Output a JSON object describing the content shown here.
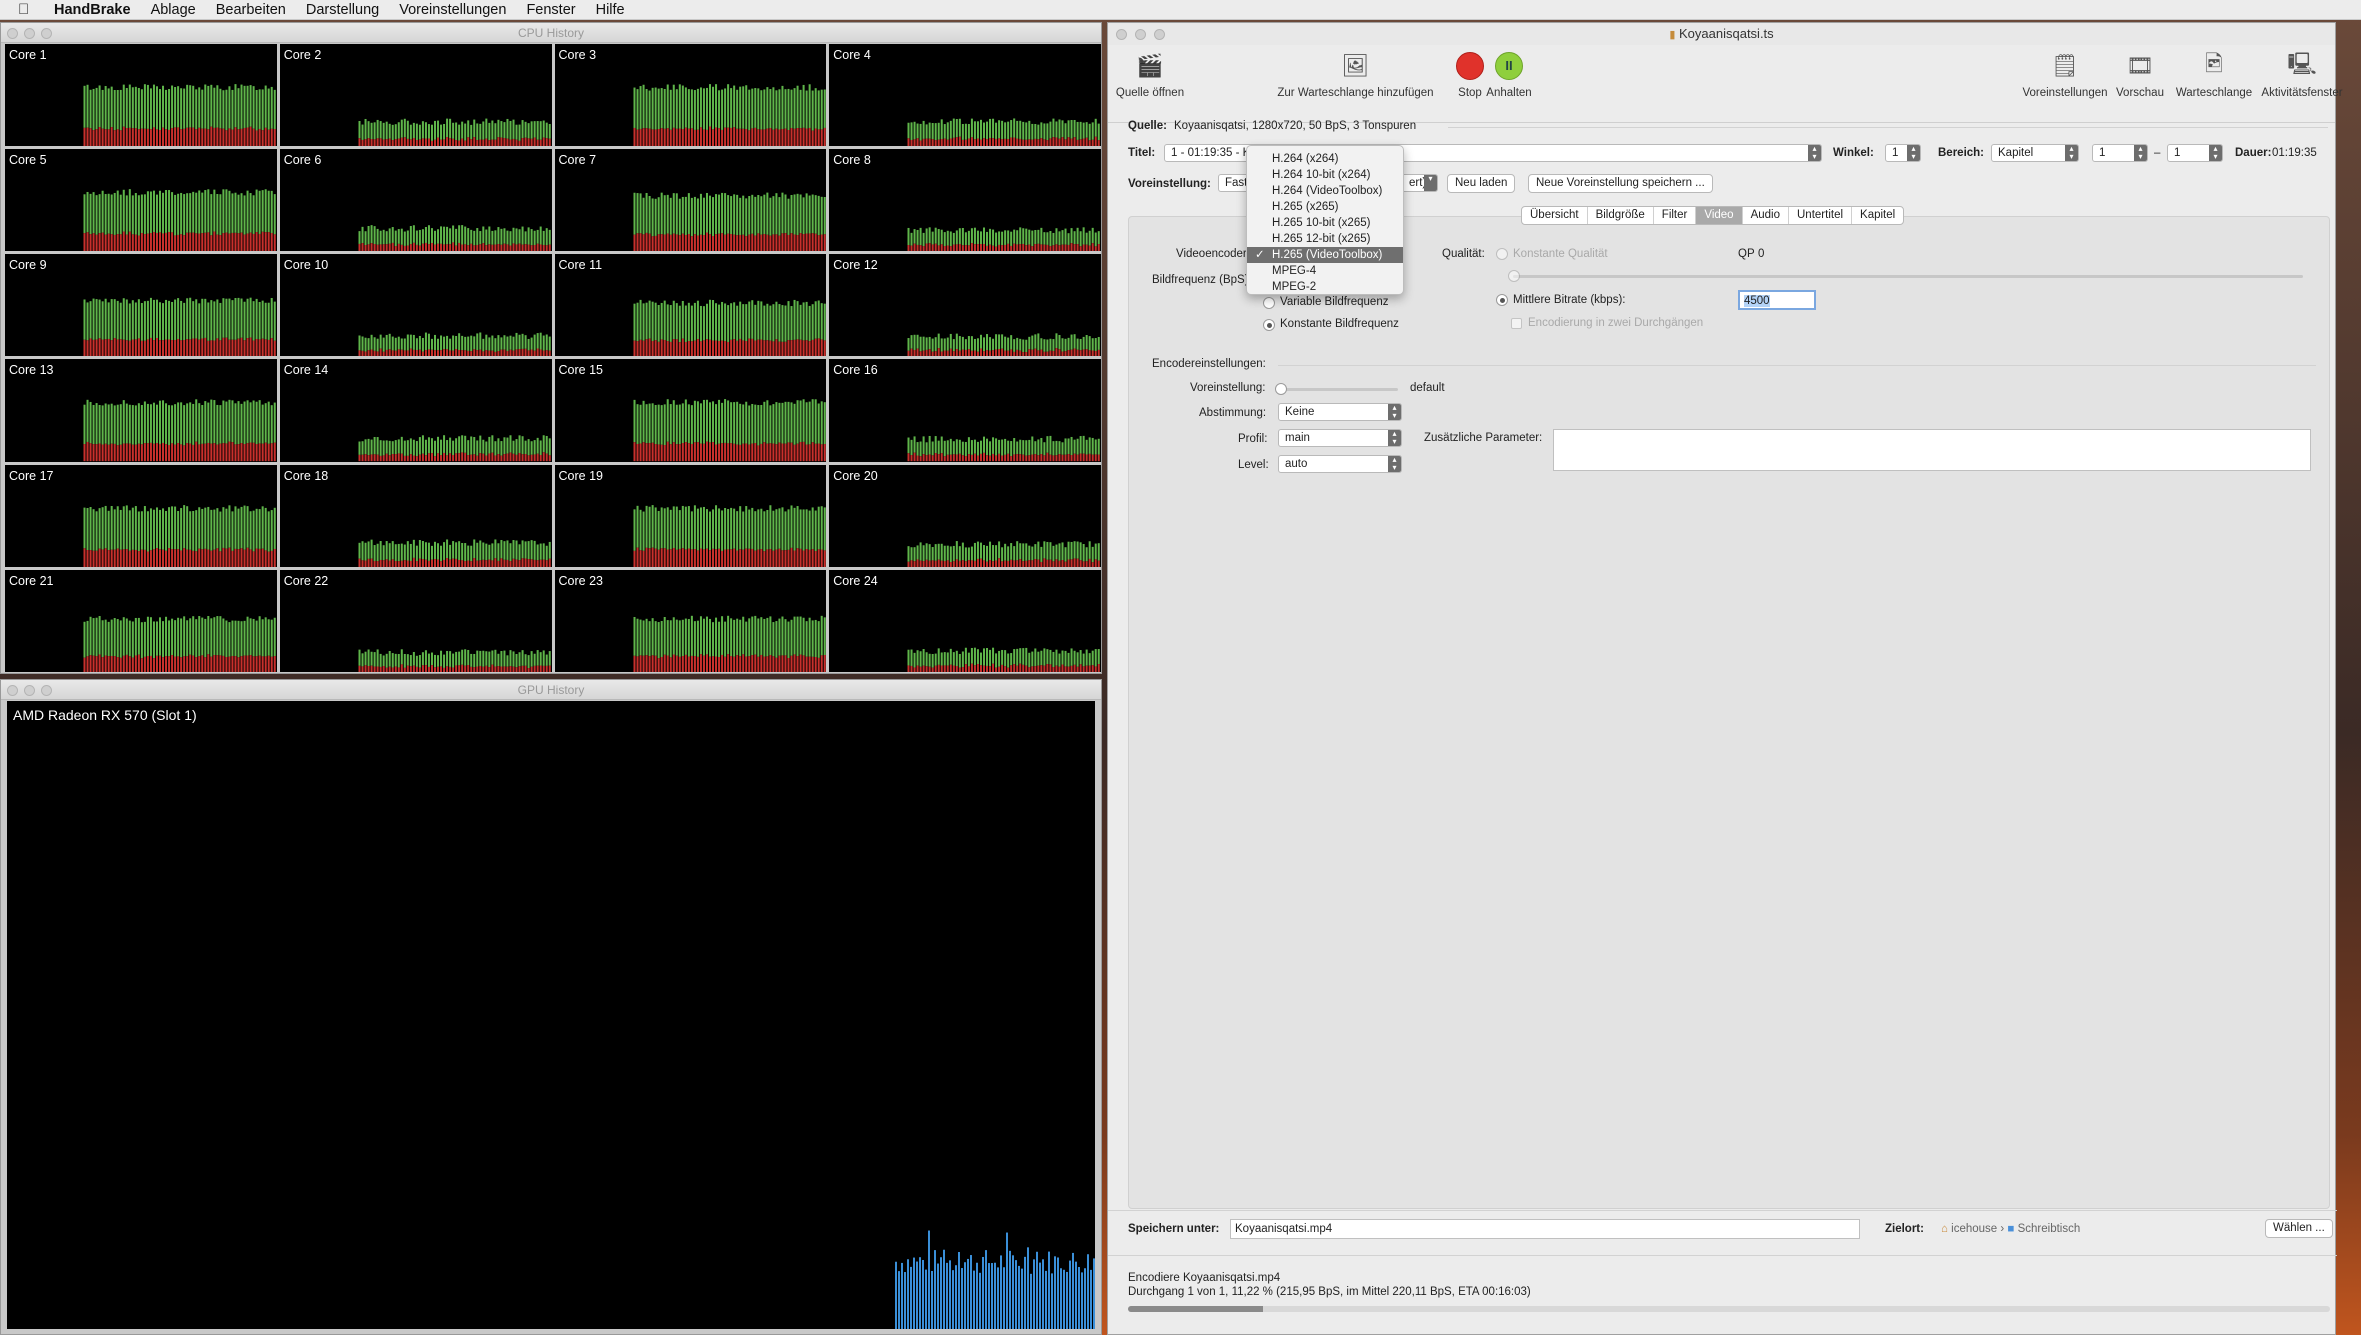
{
  "menubar": {
    "app": "HandBrake",
    "items": [
      "Ablage",
      "Bearbeiten",
      "Darstellung",
      "Voreinstellungen",
      "Fenster",
      "Hilfe"
    ]
  },
  "cpu_window": {
    "title": "CPU History",
    "cores": [
      {
        "label": "Core 1",
        "level": 0.72
      },
      {
        "label": "Core 2",
        "level": 0.3
      },
      {
        "label": "Core 3",
        "level": 0.72
      },
      {
        "label": "Core 4",
        "level": 0.3
      },
      {
        "label": "Core 5",
        "level": 0.72
      },
      {
        "label": "Core 6",
        "level": 0.28
      },
      {
        "label": "Core 7",
        "level": 0.68
      },
      {
        "label": "Core 8",
        "level": 0.26
      },
      {
        "label": "Core 9",
        "level": 0.68
      },
      {
        "label": "Core 10",
        "level": 0.25
      },
      {
        "label": "Core 11",
        "level": 0.65
      },
      {
        "label": "Core 12",
        "level": 0.24
      },
      {
        "label": "Core 13",
        "level": 0.72
      },
      {
        "label": "Core 14",
        "level": 0.28
      },
      {
        "label": "Core 15",
        "level": 0.72
      },
      {
        "label": "Core 16",
        "level": 0.27
      },
      {
        "label": "Core 17",
        "level": 0.72
      },
      {
        "label": "Core 18",
        "level": 0.3
      },
      {
        "label": "Core 19",
        "level": 0.72
      },
      {
        "label": "Core 20",
        "level": 0.28
      },
      {
        "label": "Core 21",
        "level": 0.65
      },
      {
        "label": "Core 22",
        "level": 0.24
      },
      {
        "label": "Core 23",
        "level": 0.65
      },
      {
        "label": "Core 24",
        "level": 0.26
      }
    ]
  },
  "gpu_window": {
    "title": "GPU History",
    "name": "AMD Radeon RX 570 (Slot 1)"
  },
  "hb": {
    "title": "Koyaanisqatsi.ts",
    "toolbar": {
      "open": "Quelle öffnen",
      "add_queue": "Zur Warteschlange hinzufügen",
      "stop": "Stop",
      "pause": "Anhalten",
      "presets": "Voreinstellungen",
      "preview": "Vorschau",
      "queue": "Warteschlange",
      "activity": "Aktivitätsfenster"
    },
    "source_label": "Quelle:",
    "source_value": "Koyaanisqatsi, 1280x720, 50 BpS, 3 Tonspuren",
    "title_label": "Titel:",
    "title_value": "1 - 01:19:35 - K",
    "angle_label": "Winkel:",
    "angle_value": "1",
    "range_label": "Bereich:",
    "range_value": "Kapitel",
    "range_from": "1",
    "range_dash": "–",
    "range_to": "1",
    "duration_label": "Dauer:",
    "duration_value": "01:19:35",
    "preset_label": "Voreinstellung:",
    "preset_value": "Fast",
    "preset_value_tail": "ert)",
    "reload_btn": "Neu laden",
    "save_preset_btn": "Neue Voreinstellung speichern ...",
    "tabs": [
      "Übersicht",
      "Bildgröße",
      "Filter",
      "Video",
      "Audio",
      "Untertitel",
      "Kapitel"
    ],
    "video": {
      "encoder_label": "Videoencoder",
      "framerate_label": "Bildfrequenz (BpS)",
      "vfr": "Variable Bildfrequenz",
      "cfr": "Konstante Bildfrequenz",
      "quality_label": "Qualität:",
      "const_quality": "Konstante Qualität",
      "qp_label": "QP",
      "qp_value": "0",
      "avg_bitrate": "Mittlere Bitrate (kbps):",
      "bitrate_value": "4500",
      "twopass": "Encodierung in zwei Durchgängen",
      "enc_settings": "Encodereinstellungen:",
      "preset_label": "Voreinstellung:",
      "preset_value": "default",
      "tune_label": "Abstimmung:",
      "tune_value": "Keine",
      "profile_label": "Profil:",
      "profile_value": "main",
      "level_label": "Level:",
      "level_value": "auto",
      "extra_label": "Zusätzliche Parameter:"
    },
    "encoder_menu": {
      "items": [
        "H.264 (x264)",
        "H.264 10-bit (x264)",
        "H.264 (VideoToolbox)",
        "H.265 (x265)",
        "H.265 10-bit (x265)",
        "H.265 12-bit (x265)",
        "H.265 (VideoToolbox)",
        "MPEG-4",
        "MPEG-2"
      ],
      "selected": "H.265 (VideoToolbox)",
      "check": "✓"
    },
    "save_label": "Speichern unter:",
    "save_value": "Koyaanisqatsi.mp4",
    "dest_label": "Zielort:",
    "dest_home": "icehouse",
    "dest_sep": "›",
    "dest_folder": "Schreibtisch",
    "choose_btn": "Wählen ...",
    "status_line1": "Encodiere Koyaanisqatsi.mp4",
    "status_line2": "Durchgang 1 von 1, 11,22 % (215,95 BpS, im Mittel 220,11 BpS, ETA 00:16:03)",
    "progress": 0.1122
  }
}
